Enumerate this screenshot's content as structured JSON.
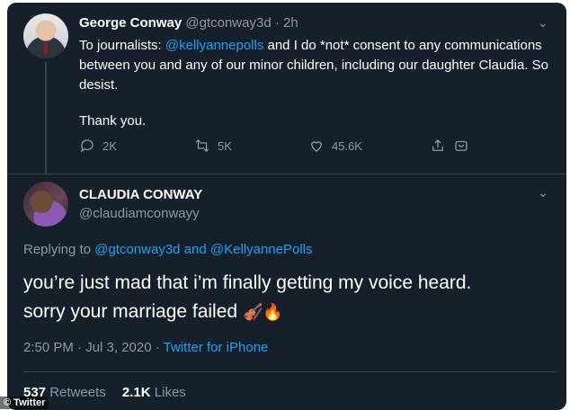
{
  "tweet1": {
    "author_name": "George Conway",
    "author_handle": "@gtconway3d",
    "time": "· 2h",
    "body_prefix": "To journalists: ",
    "mention": "@kellyannepolls",
    "body_rest": " and I do *not* consent to any communications between you and any of our minor children, including our daughter Claudia.  So desist.",
    "closing": "Thank you.",
    "replies": "2K",
    "retweets": "5K",
    "likes": "45.6K"
  },
  "tweet2": {
    "author_name": "CLAUDIA CONWAY",
    "author_handle": "@claudiamconwayy",
    "replying_label": "Replying to",
    "replying_user1": "@gtconway3d",
    "replying_and": "and",
    "replying_user2": "@KellyannePolls",
    "text_line1": "you’re just mad that i’m finally getting my voice heard.",
    "text_line2": "sorry your marriage failed",
    "emoji": "🎻🔥",
    "timestamp": "2:50 PM · Jul 3, 2020 ·",
    "source": "Twitter for iPhone",
    "retweets_count": "537",
    "retweets_label": "Retweets",
    "likes_count": "2.1K",
    "likes_label": "Likes"
  },
  "watermark": "© Twitter",
  "colors": {
    "background": "#15202b",
    "accent": "#1da1f2",
    "muted": "#8899a6",
    "divider": "#38444d"
  },
  "icons": [
    "reply-icon",
    "retweet-icon",
    "like-icon",
    "share-icon",
    "chevron-down-icon"
  ]
}
